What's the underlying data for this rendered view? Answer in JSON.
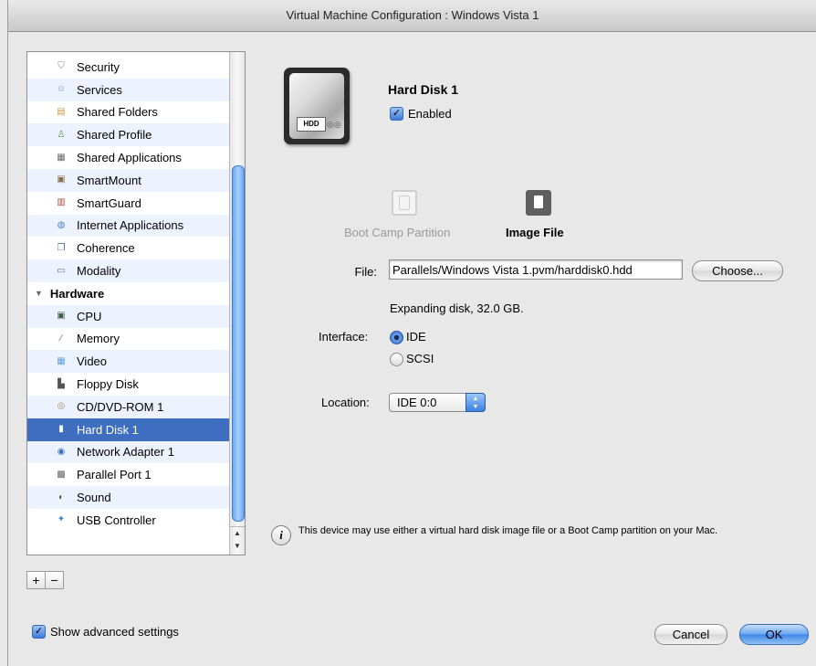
{
  "window": {
    "title": "Virtual Machine Configuration : Windows Vista 1"
  },
  "sidebar": {
    "items": [
      {
        "label": "Security",
        "icon": "shield-icon"
      },
      {
        "label": "Services",
        "icon": "services-icon"
      },
      {
        "label": "Shared Folders",
        "icon": "shared-folders-icon"
      },
      {
        "label": "Shared Profile",
        "icon": "shared-profile-icon"
      },
      {
        "label": "Shared Applications",
        "icon": "shared-applications-icon"
      },
      {
        "label": "SmartMount",
        "icon": "smartmount-icon"
      },
      {
        "label": "SmartGuard",
        "icon": "smartguard-icon"
      },
      {
        "label": "Internet Applications",
        "icon": "internet-applications-icon"
      },
      {
        "label": "Coherence",
        "icon": "coherence-icon"
      },
      {
        "label": "Modality",
        "icon": "modality-icon"
      },
      {
        "label": "Hardware",
        "group": true
      },
      {
        "label": "CPU",
        "icon": "cpu-icon"
      },
      {
        "label": "Memory",
        "icon": "memory-icon"
      },
      {
        "label": "Video",
        "icon": "video-icon"
      },
      {
        "label": "Floppy Disk",
        "icon": "floppy-disk-icon"
      },
      {
        "label": "CD/DVD-ROM 1",
        "icon": "cd-dvd-icon"
      },
      {
        "label": "Hard Disk 1",
        "icon": "hard-disk-icon",
        "selected": true
      },
      {
        "label": "Network Adapter 1",
        "icon": "network-adapter-icon"
      },
      {
        "label": "Parallel Port 1",
        "icon": "parallel-port-icon"
      },
      {
        "label": "Sound",
        "icon": "sound-icon"
      },
      {
        "label": "USB Controller",
        "icon": "usb-icon"
      }
    ],
    "add_label": "+",
    "remove_label": "−"
  },
  "advanced": {
    "label": "Show advanced settings",
    "checked": true
  },
  "device": {
    "title": "Hard Disk 1",
    "icon_label": "HDD",
    "enabled_label": "Enabled",
    "enabled": true,
    "boot_camp_label": "Boot Camp Partition",
    "image_file_label": "Image File",
    "file_label": "File:",
    "file_value": "Parallels/Windows Vista 1.pvm/harddisk0.hdd",
    "choose_label": "Choose...",
    "disk_info": "Expanding disk, 32.0 GB.",
    "interface_label": "Interface:",
    "interface_options": [
      "IDE",
      "SCSI"
    ],
    "interface_selected": "IDE",
    "location_label": "Location:",
    "location_value": "IDE 0:0",
    "info_text": "This device may use either a virtual hard disk image file or a Boot Camp partition on your Mac."
  },
  "buttons": {
    "cancel": "Cancel",
    "ok": "OK"
  },
  "colors": {
    "selection": "#3f6ec1",
    "alt_row": "#edf3fe",
    "accent": "#3f86e6"
  }
}
